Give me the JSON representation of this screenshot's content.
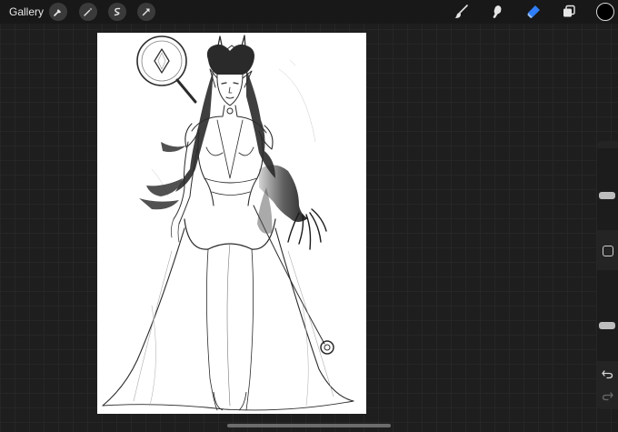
{
  "topbar": {
    "gallery_label": "Gallery",
    "left_tools": [
      "wrench-icon",
      "magic-wand-icon",
      "selection-icon",
      "transform-arrow-icon"
    ],
    "right_tools": [
      "brush-icon",
      "smudge-icon",
      "eraser-icon",
      "layers-icon"
    ],
    "active_tool": "eraser-icon",
    "active_color": "#000000",
    "accent_color": "#2f7ef7"
  },
  "sidebar": {
    "brush_size_level": 0.42,
    "opacity_level": 0.38,
    "controls": [
      "brush-size-slider",
      "modify-button",
      "opacity-slider",
      "undo-icon",
      "redo-icon"
    ]
  }
}
